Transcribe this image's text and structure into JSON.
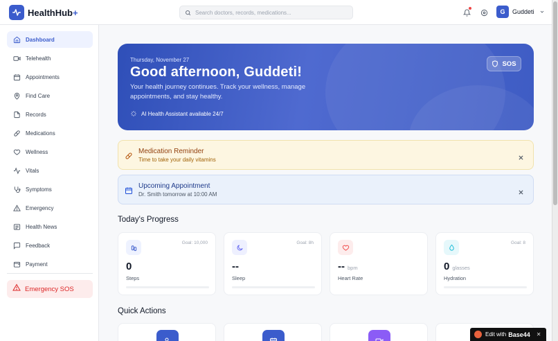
{
  "app": {
    "name": "HealthHub",
    "name_suffix": "+"
  },
  "header": {
    "search_placeholder": "Search doctors, records, medications...",
    "user_initial": "G",
    "user_name": "Guddeti"
  },
  "sidebar": {
    "items": [
      {
        "label": "Dashboard",
        "icon": "home-icon",
        "active": true
      },
      {
        "label": "Telehealth",
        "icon": "video-icon"
      },
      {
        "label": "Appointments",
        "icon": "calendar-icon"
      },
      {
        "label": "Find Care",
        "icon": "map-pin-icon"
      },
      {
        "label": "Records",
        "icon": "file-icon"
      },
      {
        "label": "Medications",
        "icon": "pill-icon"
      },
      {
        "label": "Wellness",
        "icon": "heart-icon"
      },
      {
        "label": "Vitals",
        "icon": "activity-icon"
      },
      {
        "label": "Symptoms",
        "icon": "stethoscope-icon"
      },
      {
        "label": "Emergency",
        "icon": "alert-triangle-icon"
      },
      {
        "label": "Health News",
        "icon": "newspaper-icon"
      },
      {
        "label": "Feedback",
        "icon": "message-icon"
      },
      {
        "label": "Payment",
        "icon": "wallet-icon"
      }
    ],
    "sos_label": "Emergency SOS"
  },
  "hero": {
    "date": "Thursday, November 27",
    "greeting": "Good afternoon, Guddeti!",
    "subtitle": "Your health journey continues. Track your wellness, manage appointments, and stay healthy.",
    "ai_text": "AI Health Assistant available 24/7",
    "sos_label": "SOS"
  },
  "alerts": {
    "medication": {
      "title": "Medication Reminder",
      "desc": "Time to take your daily vitamins"
    },
    "appointment": {
      "title": "Upcoming Appointment",
      "desc": "Dr. Smith tomorrow at 10:00 AM"
    }
  },
  "progress": {
    "title": "Today's Progress",
    "cards": [
      {
        "goal": "Goal: 10,000",
        "value": "0",
        "unit": "",
        "label": "Steps",
        "icon": "footprints-icon",
        "color": "#3b5ccc",
        "bg": "#eef2ff",
        "fraction": 0
      },
      {
        "goal": "Goal: 8h",
        "value": "--",
        "unit": "",
        "label": "Sleep",
        "icon": "moon-icon",
        "color": "#6366f1",
        "bg": "#eef0ff",
        "fraction": 0
      },
      {
        "goal": "",
        "value": "--",
        "unit": "bpm",
        "label": "Heart Rate",
        "icon": "heart-icon",
        "color": "#ef4444",
        "bg": "#fdecec",
        "fraction": 0
      },
      {
        "goal": "Goal: 8",
        "value": "0",
        "unit": "glasses",
        "label": "Hydration",
        "icon": "droplet-icon",
        "color": "#06b6d4",
        "bg": "#e6f8fb",
        "fraction": 0
      }
    ]
  },
  "quick_actions": {
    "title": "Quick Actions",
    "cards": [
      {
        "icon": "user-plus-icon",
        "color": "#3b5ccc"
      },
      {
        "icon": "calendar-icon",
        "color": "#3b5ccc"
      },
      {
        "icon": "video-icon",
        "color": "#8b5cf6"
      },
      {
        "icon": "",
        "color": "#ffffff"
      }
    ]
  },
  "edit_badge": {
    "text": "Edit with",
    "brand": "Base44",
    "close": "✕"
  }
}
